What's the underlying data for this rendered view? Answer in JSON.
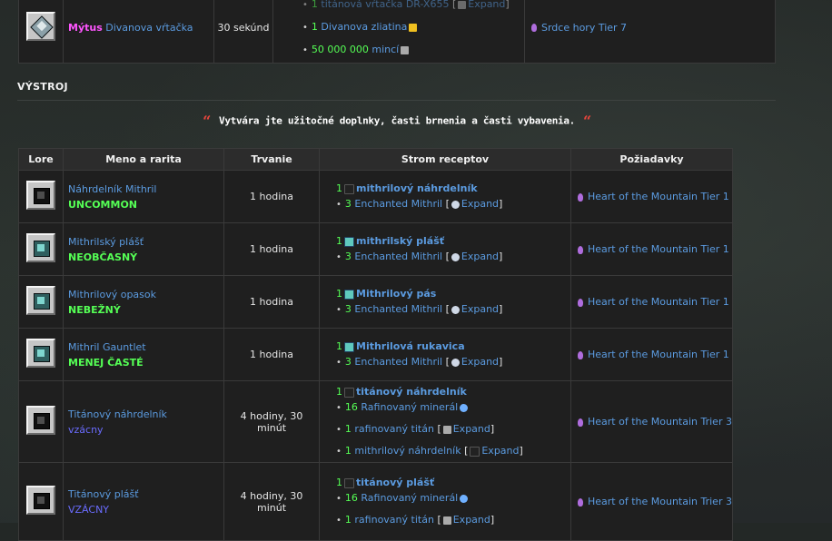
{
  "top_row": {
    "rarity": "Mýtus",
    "name": "Divanova vŕtačka",
    "duration": "30 sekúnd",
    "recipe": [
      {
        "num": "1",
        "label": "titánová vŕtačka DR-X655",
        "suffix": "[",
        "expand": "Expand",
        "close": "]"
      },
      {
        "num": "1",
        "label": "Divanova zliatina"
      },
      {
        "num": "50 000 000",
        "label": "mincí"
      }
    ],
    "requirement": "Srdce hory Tier 7"
  },
  "section": {
    "title": "VÝSTROJ",
    "quote": "Vytvára jte užitočné doplnky, časti brnenia a časti vybavenia.",
    "quote_open": "“",
    "quote_close": "“"
  },
  "table": {
    "headers": [
      "Lore",
      "Meno a rarita",
      "Trvanie",
      "Strom receptov",
      "Požiadavky"
    ],
    "rows": [
      {
        "name": "Náhrdelník Mithril",
        "rarity": "UNCOMMON",
        "duration": "1 hodina",
        "r1_num": "1",
        "r1_label": "mithrilový náhrdelník",
        "r2_num": "3",
        "r2_label": "Enchanted Mithril",
        "expand": "Expand",
        "req": "Heart of the Mountain Tier 1"
      },
      {
        "name": "Mithrilský plášť",
        "rarity": "NEOBČASNÝ",
        "duration": "1 hodina",
        "r1_num": "1",
        "r1_label": "mithrilský plášť",
        "r2_num": "3",
        "r2_label": "Enchanted Mithril",
        "expand": "Expand",
        "req": "Heart of the Mountain Tier 1"
      },
      {
        "name": "Mithrilový opasok",
        "rarity": "NEBEŽNÝ",
        "duration": "1 hodina",
        "r1_num": "1",
        "r1_label": "Mithrilový pás",
        "r2_num": "3",
        "r2_label": "Enchanted Mithril",
        "expand": "Expand",
        "req": "Heart of the Mountain Tier 1"
      },
      {
        "name": "Mithril Gauntlet",
        "rarity": "MENEJ ČASTÉ",
        "duration": "1 hodina",
        "r1_num": "1",
        "r1_label": "Mithrilová rukavica",
        "r2_num": "3",
        "r2_label": "Enchanted Mithril",
        "expand": "Expand",
        "req": "Heart of the Mountain Tier 1"
      },
      {
        "name": "Titánový náhrdelník",
        "rarity": "vzácny",
        "duration": "4 hodiny, 30 minút",
        "r1_num": "1",
        "r1_label": "titánový náhrdelník",
        "r2_num": "16",
        "r2_label": "Rafinovaný minerál",
        "r3_num": "1",
        "r3_label": "rafinovaný titán",
        "r3_expand": "Expand",
        "r4_num": "1",
        "r4_label": "mithrilový náhrdelník",
        "r4_expand": "Expand",
        "req": "Heart of the Mountain Trier 3"
      },
      {
        "name": "Titánový plášť",
        "rarity": "VZÁCNY",
        "duration": "4 hodiny, 30 minút",
        "r1_num": "1",
        "r1_label": "titánový plášť",
        "r2_num": "16",
        "r2_label": "Rafinovaný minerál",
        "r3_num": "1",
        "r3_label": "rafinovaný titán",
        "r3_expand": "Expand",
        "req": "Heart of the Mountain Trier 3"
      }
    ]
  }
}
